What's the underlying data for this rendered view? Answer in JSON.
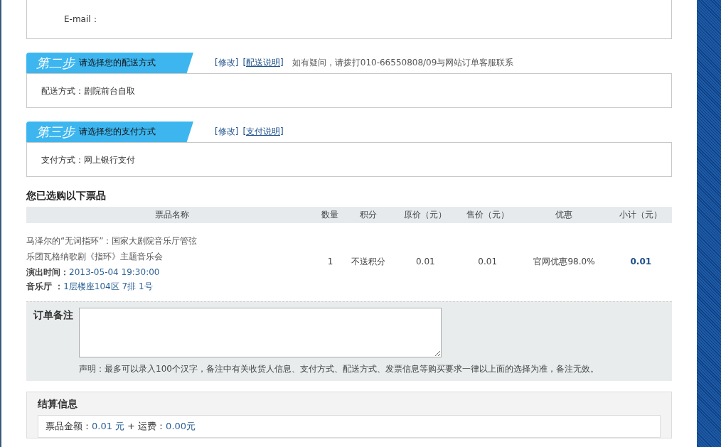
{
  "contact": {
    "email_label": "E-mail："
  },
  "steps": [
    {
      "step": "第二步",
      "title": "请选择您的配送方式",
      "links": [
        "[修改]",
        "[配送说明]"
      ],
      "note": "如有疑问，请拨打010-66550808/09与网站订单客服联系",
      "content": "配送方式：剧院前台自取"
    },
    {
      "step": "第三步",
      "title": "请选择您的支付方式",
      "links": [
        "[修改]",
        "[支付说明]"
      ],
      "content": "支付方式：网上银行支付"
    }
  ],
  "tickets": {
    "heading": "您已选购以下票品",
    "columns": [
      "票品名称",
      "数量",
      "积分",
      "原价（元）",
      "售价（元）",
      "优惠",
      "小计（元）"
    ],
    "rows": [
      {
        "name": "马泽尔的“无词指环”：国家大剧院音乐厅管弦乐团瓦格纳歌剧《指环》主题音乐会",
        "time_label": "演出时间：",
        "time": "2013-05-04 19:30:00",
        "seat_label": "音乐厅 ：",
        "seat": "1层楼座104区 7排 1号",
        "quantity": "1",
        "points": "不送积分",
        "original_price": "0.01",
        "price": "0.01",
        "discount": "官网优惠98.0%",
        "subtotal": "0.01"
      }
    ]
  },
  "remarks": {
    "label": "订单备注",
    "notice": "声明：最多可以录入100个汉字，备注中有关收货人信息、支付方式、配送方式、发票信息等购买要求一律以上面的选择为准，备注无效。"
  },
  "settlement": {
    "title": "结算信息",
    "amount_label": "票品金额：",
    "amount": "0.01 元",
    "plus": "+ 运费：",
    "shipping": "0.00元"
  }
}
